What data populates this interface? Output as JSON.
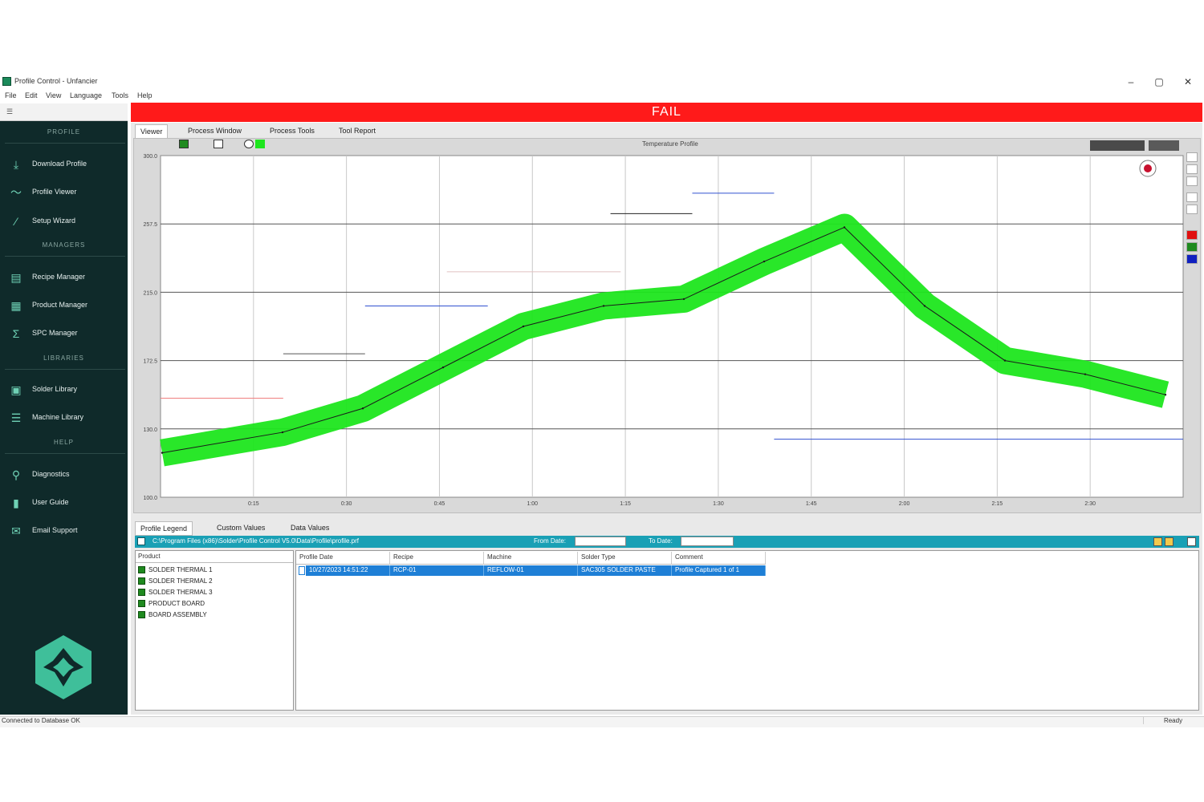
{
  "window": {
    "title": "Profile Control - Unfancier",
    "minimize": "–",
    "maximize": "▢",
    "close": "✕"
  },
  "menu": [
    "File",
    "Edit",
    "View",
    "Language",
    "Tools",
    "Help"
  ],
  "sidebar": {
    "top_icon": "☰",
    "sections": [
      {
        "label": "PROFILE",
        "items": [
          {
            "label": "Download Profile",
            "icon": "download-icon"
          },
          {
            "label": "Profile Viewer",
            "icon": "profile-icon"
          },
          {
            "label": "Setup Wizard",
            "icon": "wand-icon"
          }
        ]
      },
      {
        "label": "MANAGERS",
        "items": [
          {
            "label": "Recipe Manager",
            "icon": "recipe-icon"
          },
          {
            "label": "Product Manager",
            "icon": "product-icon"
          },
          {
            "label": "SPC Manager",
            "icon": "sigma-icon"
          }
        ]
      },
      {
        "label": "LIBRARIES",
        "items": [
          {
            "label": "Solder Library",
            "icon": "solder-icon"
          },
          {
            "label": "Machine Library",
            "icon": "machine-icon"
          }
        ]
      },
      {
        "label": "HELP",
        "items": [
          {
            "label": "Diagnostics",
            "icon": "search-icon"
          },
          {
            "label": "User Guide",
            "icon": "guide-icon"
          },
          {
            "label": "Email Support",
            "icon": "mail-icon"
          }
        ]
      }
    ]
  },
  "status_banner": "FAIL",
  "tabs": [
    "Viewer",
    "Process Window",
    "Process Tools",
    "Tool Report"
  ],
  "chart_toolbar_title": "Temperature Profile",
  "chart_data": {
    "type": "line",
    "x": [
      0,
      15,
      25,
      35,
      45,
      55,
      65,
      75,
      85,
      95,
      105,
      115,
      125
    ],
    "series": [
      {
        "values": [
          126,
          138,
          152,
          176,
          200,
          212,
          216,
          238,
          258,
          212,
          180,
          172,
          160
        ]
      }
    ],
    "band_color": "#1ee61e",
    "line_color": "#1a1a1a",
    "ylim": [
      100,
      300
    ],
    "y_ticks": [
      "300.0",
      "257.5",
      "215.0",
      "172.5",
      "130.0",
      "100.0"
    ],
    "x_ticks": [
      "0:15",
      "0:30",
      "0:45",
      "1:00",
      "1:15",
      "1:30",
      "1:45",
      "2:00",
      "2:15",
      "2:30"
    ],
    "grid": true
  },
  "bottom_tabs": [
    "Profile Legend",
    "Custom Values",
    "Data Values"
  ],
  "path_bar": {
    "path": "C:\\Program Files (x86)\\Solder\\Profile Control V5.0\\Data\\Profile\\profile.prf",
    "from_label": "From Date:",
    "to_label": "To Date:"
  },
  "left_list": {
    "header": "Product",
    "rows": [
      "SOLDER THERMAL 1",
      "SOLDER THERMAL 2",
      "SOLDER THERMAL 3",
      "PRODUCT BOARD",
      "BOARD ASSEMBLY"
    ]
  },
  "table": {
    "columns": [
      "Profile Date",
      "Recipe",
      "Machine",
      "Solder Type",
      "Comment"
    ],
    "rows": [
      [
        "10/27/2023 14:51:22",
        "RCP-01",
        "REFLOW-01",
        "SAC305 SOLDER PASTE",
        "Profile Captured 1 of 1"
      ]
    ]
  },
  "status": {
    "left": "Connected to Database OK",
    "right": "Ready"
  }
}
